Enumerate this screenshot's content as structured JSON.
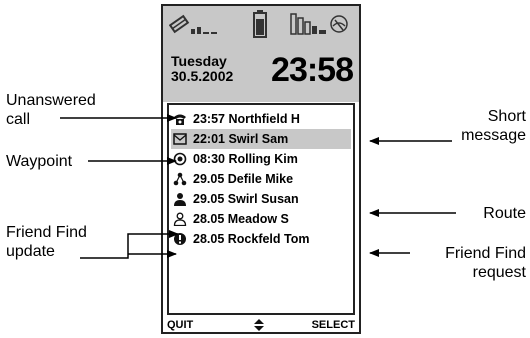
{
  "phone": {
    "day": "Tuesday",
    "date": "30.5.2002",
    "time": "23:58",
    "icons": {
      "signal": "signal-strength-icon",
      "battery": "battery-icon",
      "network": "network-tower-icon"
    }
  },
  "list": {
    "items": [
      {
        "icon": "phone-icon",
        "text": "23:57 Northfield H",
        "selected": false
      },
      {
        "icon": "envelope-icon",
        "text": "22:01 Swirl Sam",
        "selected": true
      },
      {
        "icon": "waypoint-icon",
        "text": "08:30 Rolling Kim",
        "selected": false
      },
      {
        "icon": "route-icon",
        "text": "29.05 Defile Mike",
        "selected": false
      },
      {
        "icon": "person-filled-icon",
        "text": "29.05 Swirl Susan",
        "selected": false
      },
      {
        "icon": "person-outline-icon",
        "text": "28.05 Meadow S",
        "selected": false
      },
      {
        "icon": "friend-request-icon",
        "text": "28.05 Rockfeld Tom",
        "selected": false
      }
    ]
  },
  "softkeys": {
    "left": "QUIT",
    "middle_icon": "up-down-arrows-icon",
    "right": "SELECT"
  },
  "callouts": {
    "unanswered_l1": "Unanswered",
    "unanswered_l2": "call",
    "waypoint": "Waypoint",
    "friendfind_l1": "Friend Find",
    "friendfind_l2": "update",
    "short_l1": "Short",
    "short_l2": "message",
    "route": "Route",
    "request_l1": "Friend Find",
    "request_l2": "request"
  }
}
